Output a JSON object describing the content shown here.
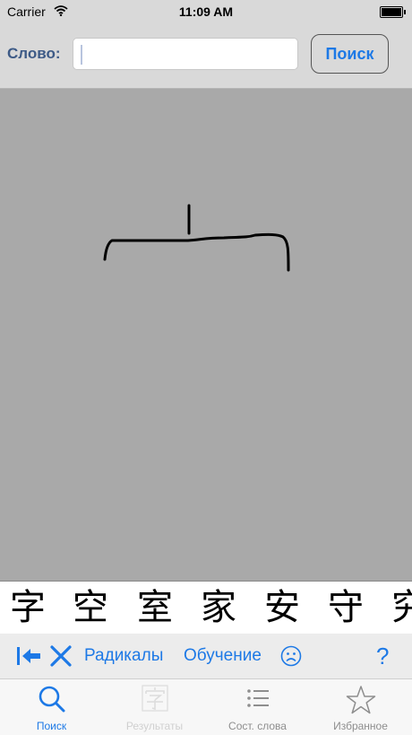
{
  "status_bar": {
    "carrier": "Carrier",
    "time": "11:09 AM"
  },
  "search": {
    "label": "Слово:",
    "input_value": "",
    "button_label": "Поиск"
  },
  "candidates": [
    "字",
    "空",
    "室",
    "家",
    "安",
    "守",
    "究"
  ],
  "toolbar": {
    "radicals_label": "Радикалы",
    "training_label": "Обучение",
    "help_label": "?"
  },
  "tabs": [
    {
      "label": "Поиск",
      "icon": "search-icon",
      "active": true
    },
    {
      "label": "Результаты",
      "icon": "kanji-icon",
      "active": false
    },
    {
      "label": "Сост. слова",
      "icon": "list-icon",
      "active": false
    },
    {
      "label": "Избранное",
      "icon": "star-icon",
      "active": false
    }
  ],
  "colors": {
    "accent": "#1d79e6",
    "canvas": "#a9a9a9",
    "bar": "#d9d9d9"
  }
}
